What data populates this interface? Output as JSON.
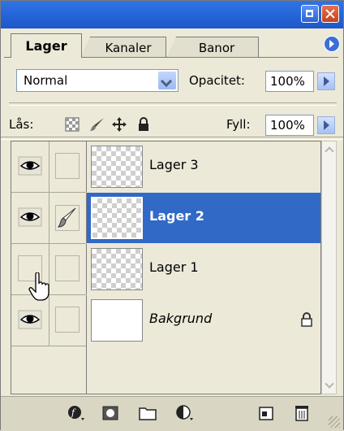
{
  "panel": {
    "tabs": [
      {
        "label": "Lager",
        "active": true
      },
      {
        "label": "Kanaler",
        "active": false
      },
      {
        "label": "Banor",
        "active": false
      }
    ]
  },
  "options": {
    "blend_mode": "Normal",
    "opacity_label": "Opacitet:",
    "opacity_value": "100%",
    "lock_label": "Lås:",
    "fill_label": "Fyll:",
    "fill_value": "100%"
  },
  "layers": [
    {
      "name": "Lager 3",
      "visible": true,
      "link": "none",
      "selected": false,
      "thumb": "transparent"
    },
    {
      "name": "Lager 2",
      "visible": true,
      "link": "brush",
      "selected": true,
      "thumb": "transparent"
    },
    {
      "name": "Lager 1",
      "visible": false,
      "link": "none",
      "selected": false,
      "thumb": "transparent"
    },
    {
      "name": "Bakgrund",
      "visible": true,
      "link": "none",
      "selected": false,
      "thumb": "white",
      "locked": true
    }
  ],
  "colors": {
    "titlebar": "#1d57c9",
    "selection": "#3169c6",
    "panel_bg": "#ece9d8"
  }
}
